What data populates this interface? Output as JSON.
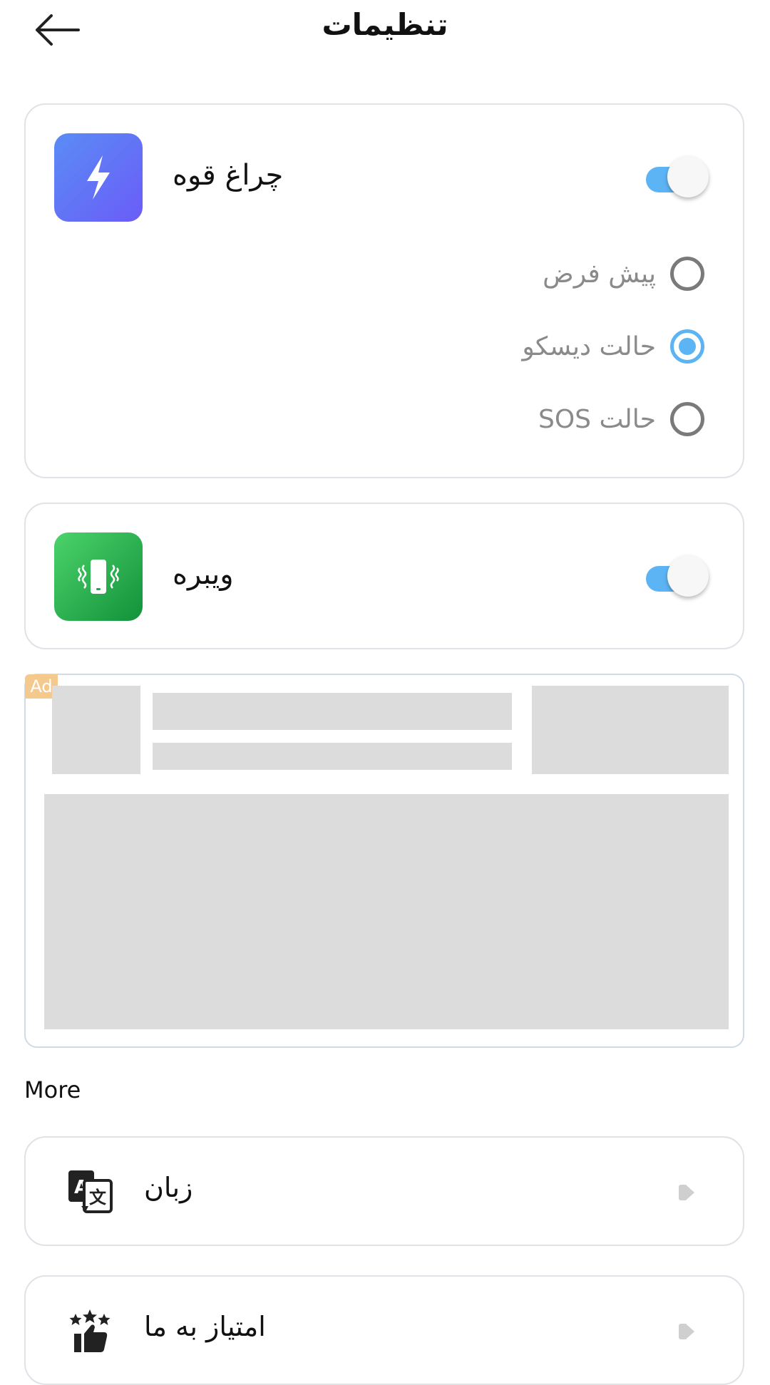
{
  "header": {
    "title": "تنظیمات",
    "back_icon": "arrow-left-icon"
  },
  "flashlight": {
    "label": "چراغ قوه",
    "icon": "lightning-bolt-icon",
    "enabled": true,
    "modes": [
      {
        "label": "پیش فرض",
        "selected": false
      },
      {
        "label": "حالت دیسکو",
        "selected": true
      },
      {
        "label": "حالت SOS",
        "selected": false
      }
    ]
  },
  "vibration": {
    "label": "ویبره",
    "icon": "phone-vibrate-icon",
    "enabled": true
  },
  "ad": {
    "badge": "Ad"
  },
  "more": {
    "title": "More",
    "items": [
      {
        "label": "زبان",
        "icon": "translate-icon"
      },
      {
        "label": "امتیاز به ما",
        "icon": "rate-stars-thumb-icon"
      }
    ]
  },
  "colors": {
    "accent": "#5db4f4",
    "flash_gradient": [
      "#5b8cf6",
      "#6a5cf7"
    ],
    "vibe_gradient": [
      "#4cd36b",
      "#12913a"
    ],
    "ad_badge": "#f5c88c",
    "placeholder": "#dcdcdc"
  }
}
